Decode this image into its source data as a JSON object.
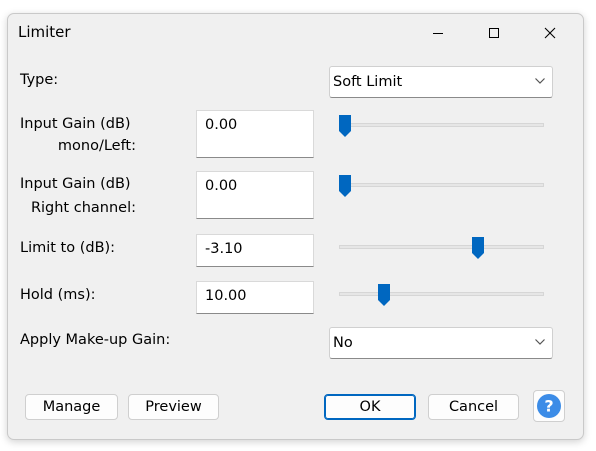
{
  "window": {
    "title": "Limiter"
  },
  "fields": {
    "type": {
      "label": "Type:",
      "value": "Soft Limit"
    },
    "input_gain_left": {
      "label_line1": "Input Gain (dB)",
      "label_line2": "mono/Left:",
      "value": "0.00",
      "slider_fraction": 0.0
    },
    "input_gain_right": {
      "label_line1": "Input Gain (dB)",
      "label_line2": "Right channel:",
      "value": "0.00",
      "slider_fraction": 0.0
    },
    "limit_to": {
      "label": "Limit to (dB):",
      "value": "-3.10",
      "slider_fraction": 0.69
    },
    "hold": {
      "label": "Hold (ms):",
      "value": "10.00",
      "slider_fraction": 0.2
    },
    "makeup_gain": {
      "label": "Apply Make-up Gain:",
      "value": "No"
    }
  },
  "buttons": {
    "manage": "Manage",
    "preview": "Preview",
    "ok": "OK",
    "cancel": "Cancel",
    "help_icon": "help-icon"
  },
  "colors": {
    "accent": "#0067c0",
    "help": "#3c8ce7"
  }
}
